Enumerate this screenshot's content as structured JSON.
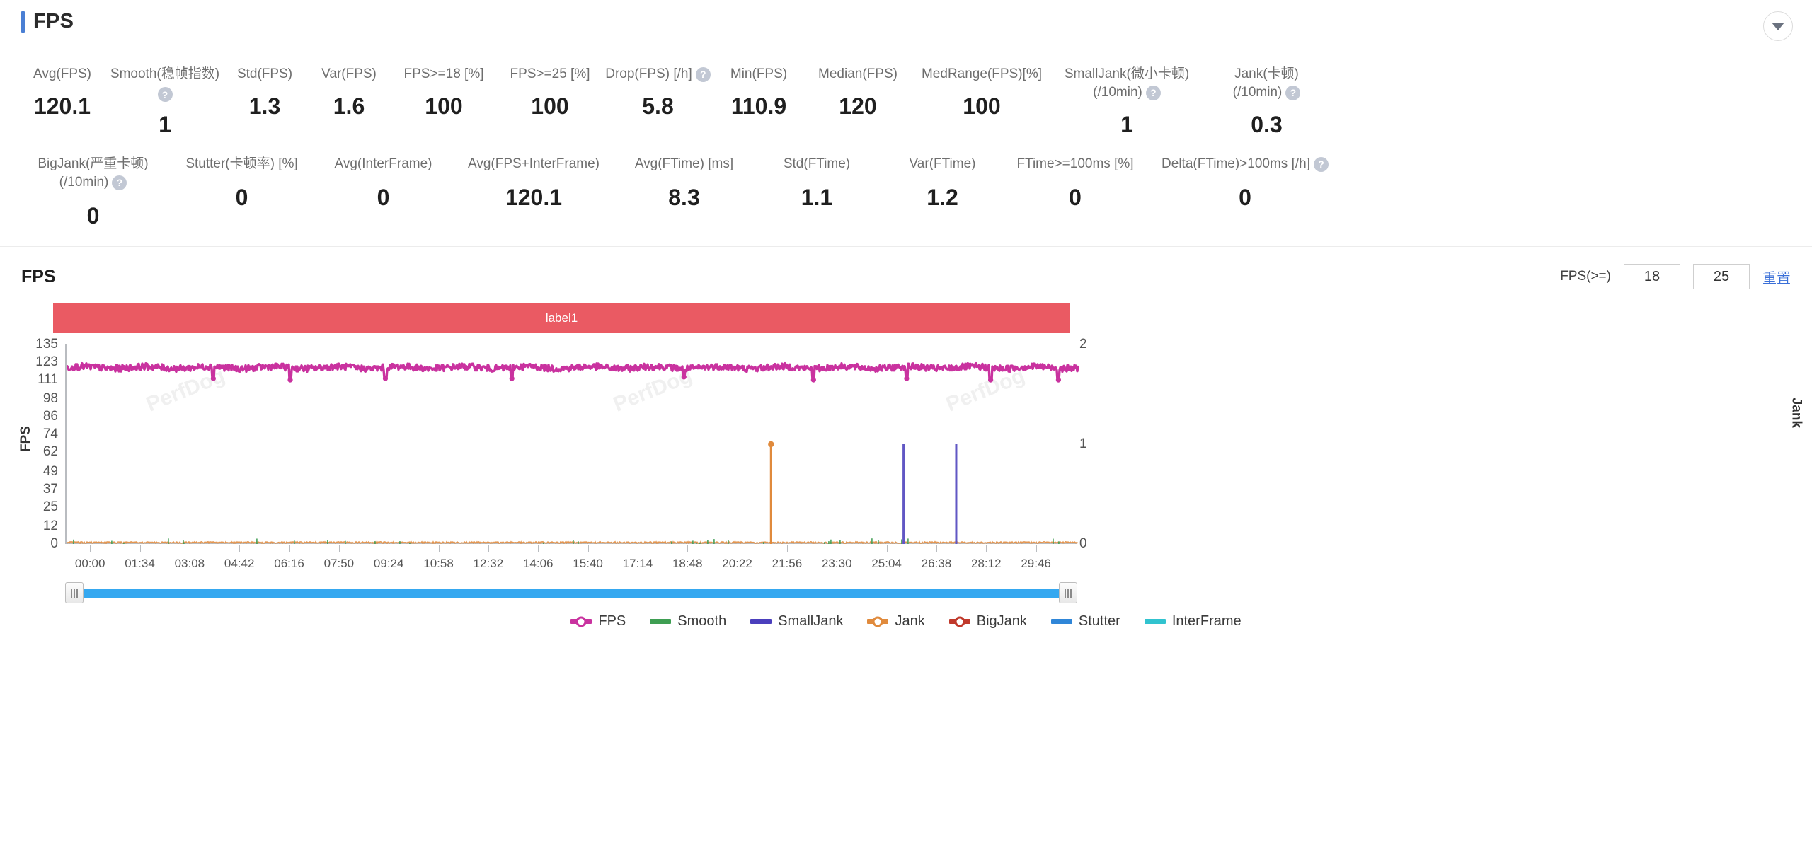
{
  "header": {
    "title": "FPS",
    "collapse_icon": "chevron-down-icon",
    "accent": "#4a7fd4"
  },
  "metrics": {
    "row1": [
      {
        "label": "Avg(FPS)",
        "value": "120.1",
        "help": false
      },
      {
        "label": "Smooth(稳帧指数)",
        "value": "1",
        "help": true
      },
      {
        "label": "Std(FPS)",
        "value": "1.3",
        "help": false
      },
      {
        "label": "Var(FPS)",
        "value": "1.6",
        "help": false
      },
      {
        "label": "FPS>=18 [%]",
        "value": "100",
        "help": false
      },
      {
        "label": "FPS>=25 [%]",
        "value": "100",
        "help": false
      },
      {
        "label": "Drop(FPS) [/h]",
        "value": "5.8",
        "help": true
      },
      {
        "label": "Min(FPS)",
        "value": "110.9",
        "help": false
      },
      {
        "label": "Median(FPS)",
        "value": "120",
        "help": false
      },
      {
        "label": "MedRange(FPS)[%]",
        "value": "100",
        "help": false
      },
      {
        "label": "SmallJank(微小卡顿)",
        "label2": "(/10min)",
        "value": "1",
        "help": true
      },
      {
        "label": "Jank(卡顿)",
        "label2": "(/10min)",
        "value": "0.3",
        "help": true
      }
    ],
    "row2": [
      {
        "label": "BigJank(严重卡顿)",
        "label2": "(/10min)",
        "value": "0",
        "help": true
      },
      {
        "label": "Stutter(卡顿率) [%]",
        "value": "0",
        "help": false
      },
      {
        "label": "Avg(InterFrame)",
        "value": "0",
        "help": false
      },
      {
        "label": "Avg(FPS+InterFrame)",
        "value": "120.1",
        "help": false
      },
      {
        "label": "Avg(FTime) [ms]",
        "value": "8.3",
        "help": false
      },
      {
        "label": "Std(FTime)",
        "value": "1.1",
        "help": false
      },
      {
        "label": "Var(FTime)",
        "value": "1.2",
        "help": false
      },
      {
        "label": "FTime>=100ms [%]",
        "value": "0",
        "help": false
      },
      {
        "label": "Delta(FTime)>100ms [/h]",
        "value": "0",
        "help": true
      }
    ]
  },
  "chart_panel": {
    "title": "FPS",
    "threshold_label": "FPS(>=)",
    "threshold_low": "18",
    "threshold_high": "25",
    "threshold_low_placeholder": "18",
    "threshold_high_placeholder": "25",
    "reset_label": "重置",
    "reset_color": "#3a6fd8",
    "label_band": {
      "text": "label1",
      "color": "#ea5a63"
    },
    "watermark": "PerfDog",
    "range_slider": {
      "start_percent": 0,
      "end_percent": 100
    }
  },
  "chart_data": {
    "type": "line",
    "title": "FPS",
    "xlabel": "",
    "ylabel": "FPS",
    "y2label": "Jank",
    "grid": false,
    "legend_position": "bottom",
    "yticks": [
      135,
      123,
      111,
      98,
      86,
      74,
      62,
      49,
      37,
      25,
      12,
      0
    ],
    "ylim": [
      0,
      135
    ],
    "y2ticks": [
      2,
      1,
      0
    ],
    "y2lim": [
      0,
      2
    ],
    "xticklabels": [
      "00:00",
      "01:34",
      "03:08",
      "04:42",
      "06:16",
      "07:50",
      "09:24",
      "10:58",
      "12:32",
      "14:06",
      "15:40",
      "17:14",
      "18:48",
      "20:22",
      "21:56",
      "23:30",
      "25:04",
      "26:38",
      "28:12",
      "29:46"
    ],
    "xlim_label": [
      "00:00",
      "30:30"
    ],
    "series": [
      {
        "name": "FPS",
        "color": "#c9329f",
        "axis": "left",
        "marker": "line-dot",
        "mean": 119.5,
        "min": 110.9,
        "max": 123,
        "description": "dense noisy band oscillating between 111 and 123 across the whole timeline with occasional downward spikes to ~111",
        "spike_dips": [
          {
            "x_percent": 14.5,
            "value": 112
          },
          {
            "x_percent": 22.1,
            "value": 111
          },
          {
            "x_percent": 31.5,
            "value": 112
          },
          {
            "x_percent": 44.0,
            "value": 112
          },
          {
            "x_percent": 61.0,
            "value": 113
          },
          {
            "x_percent": 73.8,
            "value": 111
          },
          {
            "x_percent": 83.0,
            "value": 112
          },
          {
            "x_percent": 91.3,
            "value": 111
          },
          {
            "x_percent": 98.0,
            "value": 111
          }
        ]
      },
      {
        "name": "Smooth",
        "color": "#3e9e52",
        "axis": "left",
        "marker": "bar",
        "baseline": 0,
        "description": "small green noise ticks hugging the zero baseline"
      },
      {
        "name": "SmallJank",
        "color": "#6157c4",
        "axis": "right",
        "marker": "bar",
        "spikes": [
          {
            "x_percent": 82.7,
            "value": 1
          },
          {
            "x_percent": 87.9,
            "value": 1
          }
        ],
        "description": "two tall purple spikes reaching Jank = 1 near 28:30 and 29:20"
      },
      {
        "name": "Jank",
        "color": "#e08a3c",
        "axis": "right",
        "marker": "line-dot",
        "spikes": [
          {
            "x_percent": 69.6,
            "value": 1
          }
        ],
        "description": "one orange spike with round dot top reaching Jank = 1 near 24:40, plus low amber baseline noise"
      },
      {
        "name": "BigJank",
        "color": "#c0392b",
        "axis": "right",
        "marker": "line-dot",
        "spikes": [],
        "description": "no data points"
      },
      {
        "name": "Stutter",
        "color": "#2f86d8",
        "axis": "right",
        "marker": "bar",
        "spikes": [],
        "description": "no data points"
      },
      {
        "name": "InterFrame",
        "color": "#31c3cf",
        "axis": "right",
        "marker": "bar",
        "spikes": [],
        "description": "no data points"
      }
    ]
  },
  "legend": [
    {
      "label": "FPS",
      "color": "#c9329f",
      "marker": "line-dot"
    },
    {
      "label": "Smooth",
      "color": "#3e9e52",
      "marker": "bar"
    },
    {
      "label": "SmallJank",
      "color": "#4b3fbd",
      "marker": "bar"
    },
    {
      "label": "Jank",
      "color": "#e08a3c",
      "marker": "line-dot"
    },
    {
      "label": "BigJank",
      "color": "#c0392b",
      "marker": "line-dot"
    },
    {
      "label": "Stutter",
      "color": "#2f86d8",
      "marker": "bar"
    },
    {
      "label": "InterFrame",
      "color": "#31c3cf",
      "marker": "bar"
    }
  ]
}
